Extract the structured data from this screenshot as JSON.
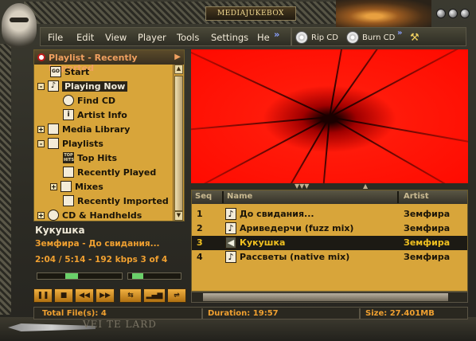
{
  "window": {
    "brand": "MEDIAJUKEBOX",
    "controls": [
      "minimize",
      "maximize",
      "close"
    ]
  },
  "menu": {
    "items": [
      "File",
      "Edit",
      "View",
      "Player",
      "Tools",
      "Settings",
      "He"
    ],
    "more": "»"
  },
  "toolbar": {
    "rip": "Rip CD",
    "burn": "Burn CD",
    "more": "»"
  },
  "left_panel": {
    "header": "Playlist - Recently Imported",
    "tree": [
      {
        "label": "Start",
        "icon": "start-icon"
      },
      {
        "label": "Playing Now",
        "icon": "now-playing-icon",
        "expander": "-",
        "selected": true
      },
      {
        "label": "Find CD",
        "icon": "cd-search-icon"
      },
      {
        "label": "Artist Info",
        "icon": "info-icon"
      },
      {
        "label": "Media Library",
        "icon": "library-icon",
        "expander": "+"
      },
      {
        "label": "Playlists",
        "icon": "playlists-icon",
        "expander": "-"
      },
      {
        "label": "Top Hits",
        "icon": "top-hits-icon"
      },
      {
        "label": "Recently Played",
        "icon": "recent-icon"
      },
      {
        "label": "Mixes",
        "icon": "mixes-icon",
        "expander": "+"
      },
      {
        "label": "Recently Imported",
        "icon": "recent-icon"
      },
      {
        "label": "CD & Handhelds",
        "icon": "cd-icon",
        "expander": "+"
      }
    ]
  },
  "now_playing": {
    "title": "Кукушка",
    "artist_track": "Земфира - До свидания...",
    "time": "2:04 / 5:14 - 192 kbps  3 of 4",
    "position_fraction": 0.39,
    "volume_fraction": 0.1
  },
  "transport": [
    "pause",
    "stop",
    "previous",
    "next",
    "shuffle",
    "equalizer",
    "repeat"
  ],
  "tracks": {
    "columns": [
      "Seq",
      "Name",
      "Artist"
    ],
    "rows": [
      {
        "seq": "1",
        "name": "До свидания...",
        "artist": "Земфира"
      },
      {
        "seq": "2",
        "name": "Ариведерчи (fuzz mix)",
        "artist": "Земфира"
      },
      {
        "seq": "3",
        "name": "Кукушка",
        "artist": "Земфира",
        "current": true
      },
      {
        "seq": "4",
        "name": "Рассветы (native mix)",
        "artist": "Земфира"
      }
    ]
  },
  "status": {
    "total": "Total File(s): 4",
    "duration": "Duration: 19:57",
    "size": "Size: 27.401MB"
  },
  "watermark": "VEI TE LARD",
  "colors": {
    "panel": "#d8a53a",
    "accent": "#f0a030",
    "visualizer": "#ff1a0a"
  }
}
